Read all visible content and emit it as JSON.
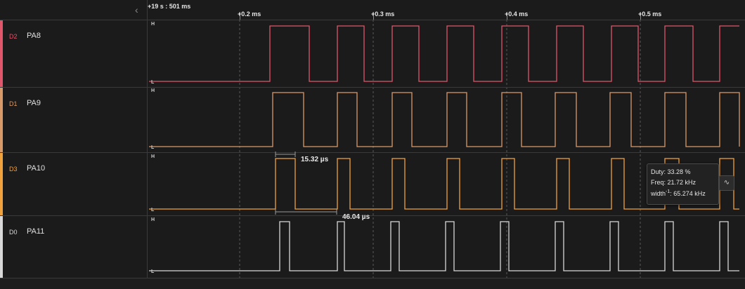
{
  "timeline": {
    "base_time": "+19 s : 501 ms",
    "ticks": [
      "+0.2 ms",
      "+0.3 ms",
      "+0.4 ms",
      "+0.5 ms"
    ],
    "collapse_icon": "chevron-left-icon"
  },
  "channels": [
    {
      "id": "D2",
      "name": "PA8",
      "color": "#e0566a",
      "high": "H",
      "low": "L"
    },
    {
      "id": "D1",
      "name": "PA9",
      "color": "#d99a6a",
      "high": "H",
      "low": "L"
    },
    {
      "id": "D3",
      "name": "PA10",
      "color": "#f2a23c",
      "high": "H",
      "low": "L"
    },
    {
      "id": "D0",
      "name": "PA11",
      "color": "#d8d8d8",
      "high": "H",
      "low": "L"
    }
  ],
  "measurements": {
    "width": "15.32 µs",
    "period": "46.04 µs"
  },
  "tooltip": {
    "duty": "Duty: 33.28 %",
    "freq": "Freq: 21.72 kHz",
    "width_prefix": "width",
    "width_sup": "-1",
    "width_value": ": 65.274 kHz",
    "action_icon": "waveform-icon"
  }
}
